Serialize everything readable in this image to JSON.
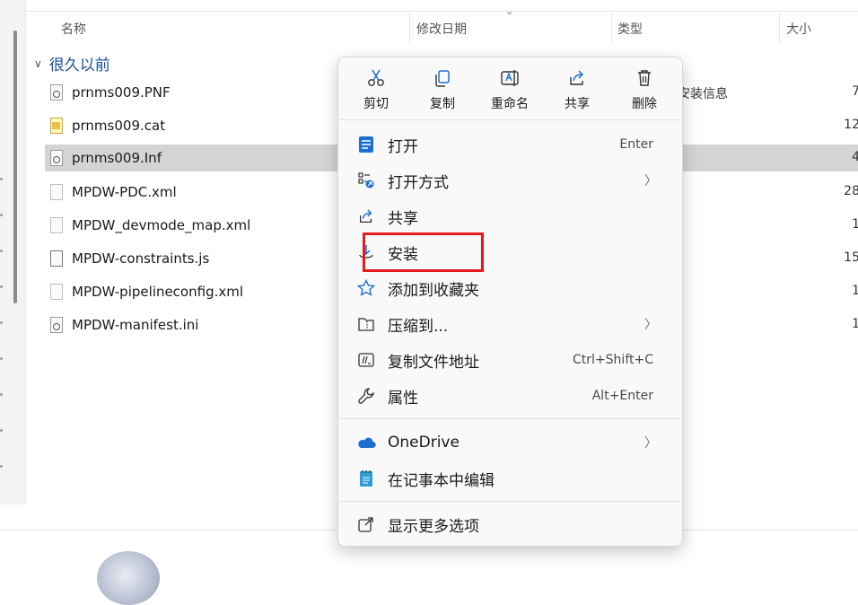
{
  "columns": {
    "name": "名称",
    "date": "修改日期",
    "type": "类型",
    "size": "大小"
  },
  "group": {
    "label": "很久以前"
  },
  "files": [
    {
      "name": "prnms009.PNF",
      "icon": "gear-file-icon",
      "type": "安装信息",
      "size": "7"
    },
    {
      "name": "prnms009.cat",
      "icon": "catalog-file-icon",
      "type": "",
      "size": "12"
    },
    {
      "name": "prnms009.Inf",
      "icon": "setup-file-icon",
      "type": "",
      "size": "4",
      "selected": true
    },
    {
      "name": "MPDW-PDC.xml",
      "icon": "blank-file-icon",
      "type": "",
      "size": "28"
    },
    {
      "name": "MPDW_devmode_map.xml",
      "icon": "blank-file-icon",
      "type": "",
      "size": "1"
    },
    {
      "name": "MPDW-constraints.js",
      "icon": "script-file-icon",
      "type": "",
      "size": "15"
    },
    {
      "name": "MPDW-pipelineconfig.xml",
      "icon": "blank-file-icon",
      "type": "",
      "size": "1"
    },
    {
      "name": "MPDW-manifest.ini",
      "icon": "settings-file-icon",
      "type": "",
      "size": "1"
    }
  ],
  "menu": {
    "toolbar": [
      {
        "label": "剪切",
        "icon": "cut-icon"
      },
      {
        "label": "复制",
        "icon": "copy-icon"
      },
      {
        "label": "重命名",
        "icon": "rename-icon"
      },
      {
        "label": "共享",
        "icon": "share-icon"
      },
      {
        "label": "删除",
        "icon": "delete-icon"
      }
    ],
    "items": {
      "open": {
        "label": "打开",
        "shortcut": "Enter"
      },
      "open_with": {
        "label": "打开方式"
      },
      "share": {
        "label": "共享"
      },
      "install": {
        "label": "安装"
      },
      "favorite": {
        "label": "添加到收藏夹"
      },
      "compress": {
        "label": "压缩到..."
      },
      "copy_path": {
        "label": "复制文件地址",
        "shortcut": "Ctrl+Shift+C"
      },
      "properties": {
        "label": "属性",
        "shortcut": "Alt+Enter"
      },
      "onedrive": {
        "label": "OneDrive"
      },
      "notepad": {
        "label": "在记事本中编辑"
      },
      "more": {
        "label": "显示更多选项"
      }
    }
  },
  "colors": {
    "accent": "#1c6fd1",
    "highlight": "#e21b1b",
    "selected_row": "#d4d4d4"
  }
}
